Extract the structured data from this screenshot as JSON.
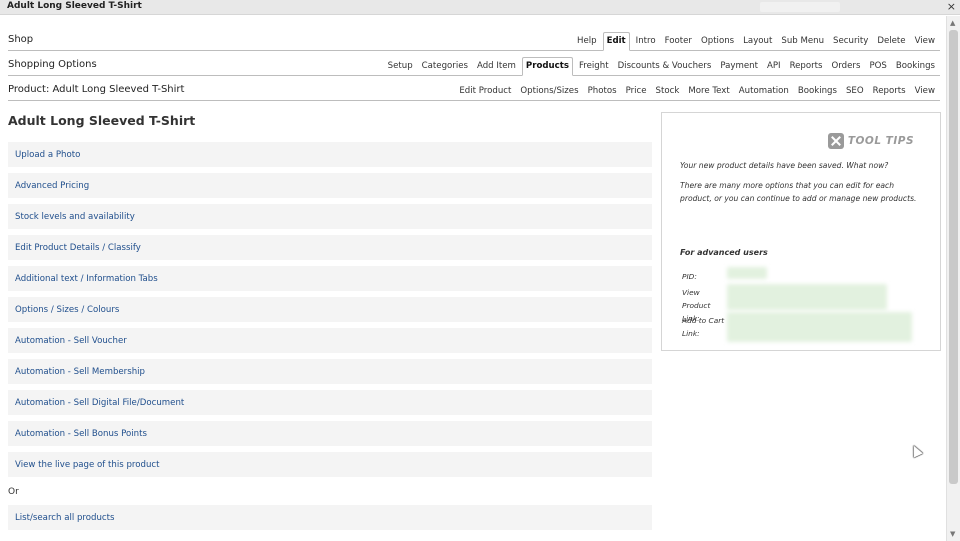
{
  "window": {
    "title": "Adult Long Sleeved T-Shirt",
    "close_glyph": "×"
  },
  "nav_rows": [
    {
      "title": "Shop",
      "tabs": [
        "Help",
        "Edit",
        "Intro",
        "Footer",
        "Options",
        "Layout",
        "Sub Menu",
        "Security",
        "Delete",
        "View"
      ],
      "active": "Edit"
    },
    {
      "title": "Shopping Options",
      "tabs": [
        "Setup",
        "Categories",
        "Add Item",
        "Products",
        "Freight",
        "Discounts & Vouchers",
        "Payment",
        "API",
        "Reports",
        "Orders",
        "POS",
        "Bookings"
      ],
      "active": "Products"
    },
    {
      "title": "Product: Adult Long Sleeved T-Shirt",
      "tabs": [
        "Edit Product",
        "Options/Sizes",
        "Photos",
        "Price",
        "Stock",
        "More Text",
        "Automation",
        "Bookings",
        "SEO",
        "Reports",
        "View"
      ],
      "active": ""
    }
  ],
  "page": {
    "heading": "Adult Long Sleeved T-Shirt",
    "links": [
      "Upload a Photo",
      "Advanced Pricing",
      "Stock levels and availability",
      "Edit Product Details / Classify",
      "Additional text / Information Tabs",
      "Options / Sizes / Colours",
      "Automation - Sell Voucher",
      "Automation - Sell Membership",
      "Automation - Sell Digital File/Document",
      "Automation - Sell Bonus Points",
      "View the live page of this product"
    ],
    "or_label": "Or",
    "after_links": [
      "List/search all products"
    ]
  },
  "tooltips": {
    "logo_text": "TOOL TIPS",
    "logo_icon": "tools-icon",
    "saved_message": "Your new product details have been saved. What now?",
    "help_message": "There are many more options that you can edit for each product, or you can continue to add or manage new products.",
    "advanced_heading": "For advanced users",
    "fields": [
      {
        "label_line1": "PID:",
        "label_line2": ""
      },
      {
        "label_line1": "View Product",
        "label_line2": "Link:"
      },
      {
        "label_line1": "Add to Cart",
        "label_line2": "Link:"
      }
    ]
  },
  "colors": {
    "link": "#1f4e8c",
    "row_bg": "#f4f4f4",
    "redacted": "#e2f1df"
  }
}
